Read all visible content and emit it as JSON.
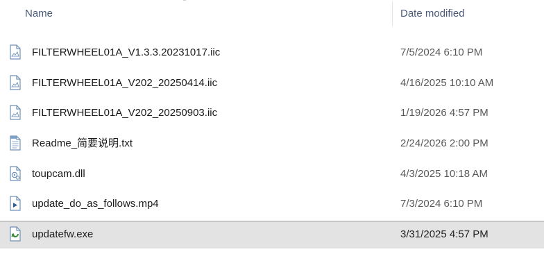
{
  "columns": {
    "name": "Name",
    "date_modified": "Date modified"
  },
  "files": [
    {
      "name": "FILTERWHEEL01A_V1.3.3.20231017.iic",
      "date": "7/5/2024 6:10 PM",
      "icon": "generic-file-icon"
    },
    {
      "name": "FILTERWHEEL01A_V202_20250414.iic",
      "date": "4/16/2025 10:10 AM",
      "icon": "generic-file-icon"
    },
    {
      "name": "FILTERWHEEL01A_V202_20250903.iic",
      "date": "1/19/2026 4:57 PM",
      "icon": "generic-file-icon"
    },
    {
      "name": "Readme_简要说明.txt",
      "date": "2/24/2026 2:00 PM",
      "icon": "text-file-icon"
    },
    {
      "name": "toupcam.dll",
      "date": "4/3/2025 10:18 AM",
      "icon": "dll-file-icon"
    },
    {
      "name": "update_do_as_follows.mp4",
      "date": "7/3/2024 6:10 PM",
      "icon": "video-file-icon"
    },
    {
      "name": "updatefw.exe",
      "date": "3/31/2025 4:57 PM",
      "icon": "exe-file-icon",
      "selected": true
    }
  ]
}
